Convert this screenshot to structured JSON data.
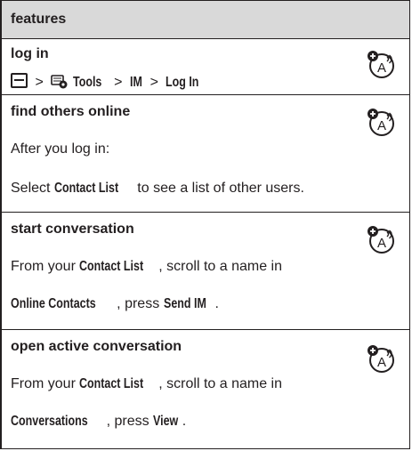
{
  "header": {
    "title": "features"
  },
  "sections": [
    {
      "title": "log in",
      "path": {
        "sep": ">",
        "tools": "Tools",
        "im": "IM",
        "login": "Log In"
      }
    },
    {
      "title": "find others online",
      "line1": "After you log in:",
      "line2_pre": "Select ",
      "line2_bold": "Contact List",
      "line2_post": " to see a list of other users."
    },
    {
      "title": "start conversation",
      "line1_pre": "From your ",
      "line1_bold": "Contact List",
      "line1_post": ", scroll to a name in",
      "line2_bold": "Online Contacts",
      "line2_mid": ", press ",
      "line2_bold2": "Send IM",
      "line2_post": "."
    },
    {
      "title": "open active conversation",
      "line1_pre": "From your ",
      "line1_bold": "Contact List",
      "line1_post": ", scroll to a name in",
      "line2_bold": "Conversations",
      "line2_mid": ", press ",
      "line2_bold2": "View",
      "line2_post": "."
    }
  ],
  "icons": {
    "network_feature": "network-feature-icon",
    "menu_key": "menu-key-icon",
    "tools": "tools-icon"
  }
}
